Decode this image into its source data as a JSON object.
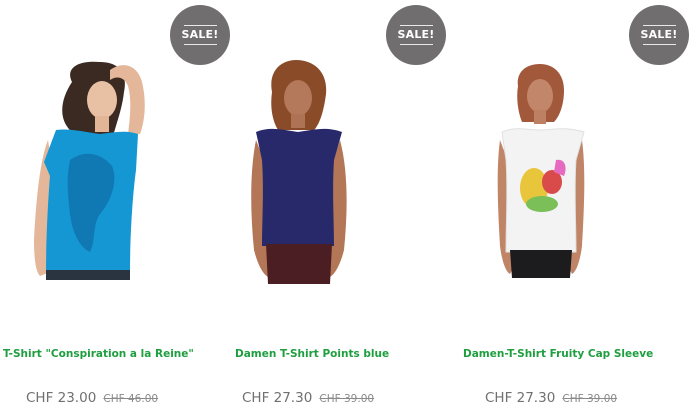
{
  "products": [
    {
      "badge": "SALE!",
      "title": "T-Shirt \"Conspiration a la Reine\"",
      "price": "CHF 23.00",
      "old_price": "CHF 46.00",
      "shirt_color": "#1597d3"
    },
    {
      "badge": "SALE!",
      "title": "Damen T-Shirt Points blue",
      "price": "CHF 27.30",
      "old_price": "CHF 39.00",
      "shirt_color": "#27296a"
    },
    {
      "badge": "SALE!",
      "title": "Damen-T-Shirt Fruity Cap Sleeve",
      "price": "CHF 27.30",
      "old_price": "CHF 39.00",
      "shirt_color": "#f3f3f3"
    }
  ],
  "colors": {
    "title_green": "#1e9e3e",
    "badge_gray": "#706e6f",
    "price_gray": "#707070"
  }
}
